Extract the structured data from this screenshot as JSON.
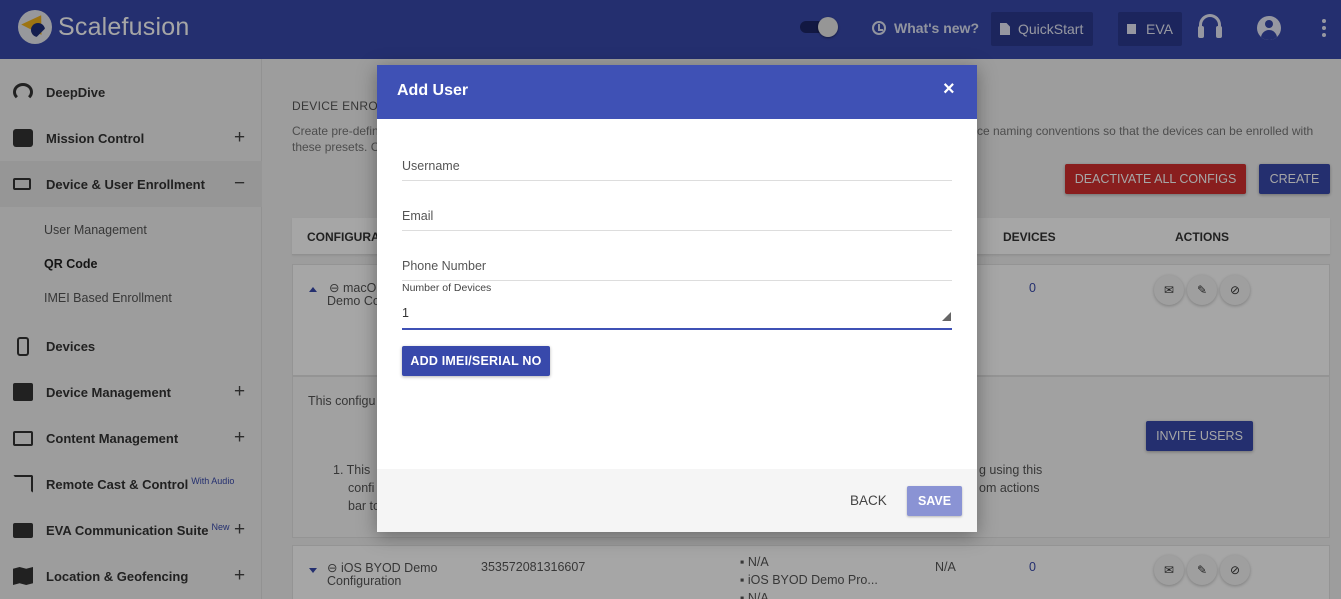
{
  "header": {
    "brand": "Scalefusion",
    "whats_new": "What's new?",
    "quickstart": "QuickStart",
    "eva": "EVA"
  },
  "sidebar": {
    "items": [
      {
        "label": "DeepDive",
        "icon": "gauge-icon",
        "expand": ""
      },
      {
        "label": "Mission Control",
        "icon": "box-icon",
        "expand": "+"
      },
      {
        "label": "Device & User Enrollment",
        "icon": "devices-icon",
        "expand": "−"
      },
      {
        "label": "Devices",
        "icon": "phone-icon",
        "expand": ""
      },
      {
        "label": "Device Management",
        "icon": "briefcase-icon",
        "expand": "+"
      },
      {
        "label": "Content Management",
        "icon": "folder-icon",
        "expand": "+"
      },
      {
        "label": "Remote Cast & Control",
        "badge": "With Audio",
        "icon": "cast-icon",
        "expand": ""
      },
      {
        "label": "EVA Communication Suite",
        "badge": "New",
        "icon": "chat-icon",
        "expand": "+"
      },
      {
        "label": "Location & Geofencing",
        "icon": "map-icon",
        "expand": "+"
      }
    ],
    "sub_items": [
      "User Management",
      "QR Code",
      "IMEI Based Enrollment"
    ]
  },
  "main": {
    "title": "DEVICE ENRO",
    "desc_left": "Create pre-defin",
    "desc_left2": "these presets. C",
    "desc_right": "ce naming conventions so that the devices can be enrolled with",
    "deactivate": "DEACTIVATE ALL CONFIGS",
    "create": "CREATE",
    "columns": {
      "config": "CONFIGURAT",
      "devices": "DEVICES",
      "actions": "ACTIONS"
    },
    "row1": {
      "name1": "macO",
      "name2": "Demo Co",
      "devices": "0"
    },
    "detail": {
      "intro": "This configu",
      "invite": "INVITE USERS",
      "step_prefix": "1. This",
      "line2": "confi",
      "line3": "bar to",
      "right1": "g using this",
      "right2": "om actions"
    },
    "row2": {
      "name1": "iOS BYOD Demo",
      "name2": "Configuration",
      "code": "353572081316607",
      "platform1": "N/A",
      "platform2": "iOS BYOD Demo Pro...",
      "platform3": "N/A",
      "status": "N/A",
      "devices": "0"
    }
  },
  "modal": {
    "title": "Add User",
    "close": "×",
    "username_placeholder": "Username",
    "email_placeholder": "Email",
    "phone_placeholder": "Phone Number",
    "count_label": "Number of Devices",
    "count_value": "1",
    "add_imei": "ADD IMEI/SERIAL NO",
    "back": "BACK",
    "save": "SAVE"
  }
}
